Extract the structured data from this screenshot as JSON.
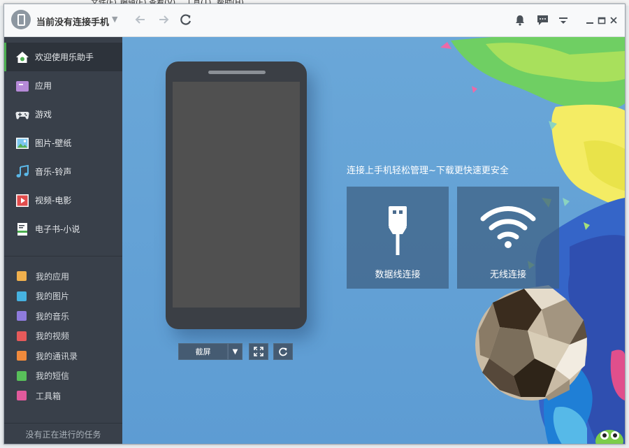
{
  "window": {
    "accent": "#4caf50",
    "sidebar_bg": "#39404a"
  },
  "background_menu": [
    "文件(F)",
    "编辑(E)",
    "查看(V)",
    "工具(T)",
    "帮助(H)"
  ],
  "titlebar": {
    "device_status": "当前没有连接手机",
    "icons": [
      "back-icon",
      "forward-icon",
      "refresh-icon",
      "bell-icon",
      "chat-icon",
      "menu-icon",
      "minimize-icon",
      "maximize-icon",
      "close-icon"
    ]
  },
  "sidebar": {
    "items": [
      {
        "label": "欢迎使用乐助手",
        "icon": "home-icon",
        "active": true
      },
      {
        "label": "应用",
        "icon": "apps-icon"
      },
      {
        "label": "游戏",
        "icon": "gamepad-icon"
      },
      {
        "label": "图片-壁纸",
        "icon": "picture-icon"
      },
      {
        "label": "音乐-铃声",
        "icon": "music-icon"
      },
      {
        "label": "视频-电影",
        "icon": "video-icon"
      },
      {
        "label": "电子书-小说",
        "icon": "ebook-icon"
      }
    ],
    "my_items": [
      {
        "label": "我的应用",
        "color": "#f0b04d"
      },
      {
        "label": "我的图片",
        "color": "#46b2e0"
      },
      {
        "label": "我的音乐",
        "color": "#8e7bdd"
      },
      {
        "label": "我的视频",
        "color": "#e65a5a"
      },
      {
        "label": "我的通讯录",
        "color": "#f08a3c"
      },
      {
        "label": "我的短信",
        "color": "#58c05a"
      },
      {
        "label": "工具箱",
        "color": "#e15a9c"
      }
    ],
    "footer": "没有正在进行的任务"
  },
  "main": {
    "tagline": "连接上手机轻松管理~下载更快速更安全",
    "screenshot_button": "截屏",
    "connect_usb": "数据线连接",
    "connect_wifi": "无线连接"
  }
}
